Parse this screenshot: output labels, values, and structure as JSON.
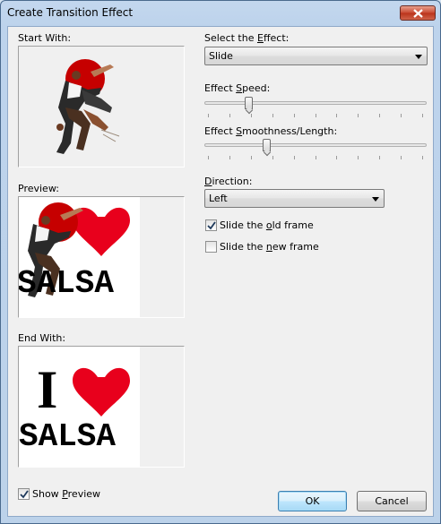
{
  "window": {
    "title": "Create Transition Effect",
    "close_icon": "close-x-icon"
  },
  "left": {
    "start_with_label": "Start With:",
    "preview_label": "Preview:",
    "end_with_label": "End With:",
    "image_text": {
      "i_letter": "I",
      "salsa_word": "SALSA"
    }
  },
  "effect": {
    "label_pre": "Select the ",
    "label_key": "E",
    "label_post": "ffect:",
    "value": "Slide"
  },
  "speed": {
    "label_pre": "Effect ",
    "label_key": "S",
    "label_post": "peed:",
    "value_fraction": 0.19
  },
  "smoothness": {
    "label_pre": "Effect ",
    "label_key": "S",
    "label_post": "moothness/Length:",
    "value_fraction": 0.27
  },
  "direction": {
    "label_key": "D",
    "label_post": "irection:",
    "value": "Left"
  },
  "options": {
    "old_pre": "Slide the ",
    "old_key": "o",
    "old_post": "ld frame",
    "old_checked": true,
    "new_pre": "Slide the ",
    "new_key": "n",
    "new_post": "ew frame",
    "new_checked": false
  },
  "footer": {
    "show_pre": "Show ",
    "show_key": "P",
    "show_post": "review",
    "show_checked": true,
    "ok_label": "OK",
    "cancel_label": "Cancel"
  },
  "colors": {
    "heart": "#e8001c",
    "sun": "#c60000"
  }
}
